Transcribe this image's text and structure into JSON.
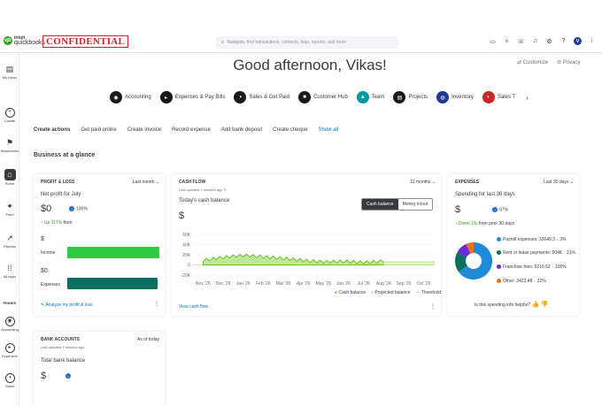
{
  "brand": {
    "intuit": "intuit",
    "product": "quickbooks",
    "banner": "CONFIDENTIAL"
  },
  "search": {
    "placeholder": "Navigate, find transactions, contacts, help, reports, and more"
  },
  "topbar_icons": [
    "clipboard-icon",
    "lightbulb-icon",
    "phone-icon",
    "bell-icon",
    "settings-icon",
    "help-icon",
    "user-avatar-icon",
    "apps-icon"
  ],
  "avatar_initial": "V",
  "sidebar": {
    "items": [
      {
        "label": "My menu",
        "icon": "menu-icon",
        "glyph": "▤"
      },
      {
        "label": "Create",
        "icon": "plus-icon",
        "glyph": "+"
      },
      {
        "label": "Bookmarks",
        "icon": "bookmark-icon",
        "glyph": "⚑"
      },
      {
        "label": "Home",
        "icon": "home-icon",
        "glyph": "⌂"
      },
      {
        "label": "Feed",
        "icon": "feed-icon",
        "glyph": "✦"
      },
      {
        "label": "Reports",
        "icon": "reports-icon",
        "glyph": "↗"
      },
      {
        "label": "All apps",
        "icon": "grid-icon",
        "glyph": "⁞⁞"
      },
      {
        "label": "Accounting",
        "icon": "accounting-icon",
        "glyph": "◉"
      },
      {
        "label": "Expenses",
        "icon": "expenses-icon",
        "glyph": "▸"
      },
      {
        "label": "Sales",
        "icon": "sales-icon",
        "glyph": "◑"
      }
    ],
    "pinned_label": "PINNED"
  },
  "greeting": "Good afternoon, Vikas!",
  "header_links": {
    "customize": "Customize",
    "privacy": "Privacy"
  },
  "nav_pills": [
    {
      "label": "Accounting",
      "color": "#1a1a1a"
    },
    {
      "label": "Expenses & Pay Bills",
      "color": "#1a1a1a"
    },
    {
      "label": "Sales & Get Paid",
      "color": "#1a1a1a"
    },
    {
      "label": "Customer Hub",
      "color": "#1a1a1a"
    },
    {
      "label": "Team",
      "color": "#0097a7"
    },
    {
      "label": "Projects",
      "color": "#1a1a1a"
    },
    {
      "label": "Inventory",
      "color": "#1f3a93"
    },
    {
      "label": "Sales T",
      "color": "#c62828"
    }
  ],
  "create_actions": {
    "heading": "Create actions",
    "items": [
      "Get paid online",
      "Create invoice",
      "Record expense",
      "Add bank deposit",
      "Create cheque"
    ],
    "show_all": "Show all"
  },
  "section_title": "Business at a glance",
  "profit_loss": {
    "title": "PROFIT & LOSS",
    "period": "Last month",
    "subtitle": "Net profit for July",
    "net_amount": "$0",
    "badge_pct": "100%",
    "change": "Up 117%",
    "change_suffix": "from",
    "income_value": "$",
    "income_label": "Income",
    "income_share": 1.0,
    "expenses_value": "$0",
    "expenses_label": "Expenses",
    "expenses_share": 0.98,
    "analyze_link": "Analyze my profit & loss"
  },
  "cash_flow": {
    "title": "CASH FLOW",
    "period": "12 months",
    "updated": "Last updated 7 minutes ago",
    "subtitle": "Today's cash balance",
    "amount": "$",
    "toggle": [
      "Cash balance",
      "Money in/out"
    ],
    "view_link": "View cash flow",
    "legend": [
      "Cash balance",
      "Projected balance",
      "Threshold"
    ]
  },
  "expenses": {
    "title": "EXPENSES",
    "period": "Last 30 days",
    "subtitle": "Spending for last 30 days",
    "amount": "$",
    "badge_pct": "97%",
    "change": "Down 1%",
    "change_suffix": "from prior 30 days",
    "rows": [
      {
        "label": "Payroll expenses: 32649.3",
        "trend": "3%",
        "dir": "down",
        "color": "#e8711f"
      },
      {
        "label": "Rent or lease payments: 9048",
        "trend": "21%",
        "dir": "up",
        "color": "#2ca01c"
      },
      {
        "label": "Franchise fees: 5216.52",
        "trend": "100%",
        "dir": "up",
        "color": "#6c2bd9"
      },
      {
        "label": "Other: 3422.48",
        "trend": "22%",
        "dir": "up",
        "color": "#e8711f"
      }
    ],
    "helpful_q": "Is this spending info helpful?"
  },
  "bank_accounts": {
    "title": "BANK ACCOUNTS",
    "as_of": "As of today",
    "updated": "Last updated 7 minutes ago",
    "subtitle": "Total bank balance",
    "amount": "$"
  },
  "chart_data": {
    "type": "area",
    "x": [
      "Nov '25",
      "Dec '25",
      "Jan '26",
      "Feb '26",
      "Mar '26",
      "Apr '26",
      "May '26",
      "Jun '26",
      "Jul '26",
      "Aug '26",
      "Sep '26",
      "Oct '26"
    ],
    "yticks": [
      "60K",
      "40K",
      "20K",
      "0",
      "-20K"
    ],
    "ylim": [
      -20000,
      60000
    ],
    "series": [
      {
        "name": "Cash balance",
        "color": "#53b700",
        "values": [
          8000,
          14000,
          18000,
          15000,
          12000,
          8000,
          5000,
          6000,
          4000,
          6000,
          null,
          null
        ]
      },
      {
        "name": "Projected balance",
        "color": "#a8e07a",
        "values": [
          null,
          null,
          null,
          null,
          null,
          null,
          null,
          null,
          null,
          6000,
          6000,
          6000
        ]
      }
    ],
    "donut": [
      {
        "label": "Payroll expenses",
        "value": 32649.3,
        "color": "#1f8ad8"
      },
      {
        "label": "Rent or lease payments",
        "value": 9048,
        "color": "#0b6e5e"
      },
      {
        "label": "Franchise fees",
        "value": 5216.52,
        "color": "#6c2bd9"
      },
      {
        "label": "Other",
        "value": 3422.48,
        "color": "#e8711f"
      }
    ]
  }
}
